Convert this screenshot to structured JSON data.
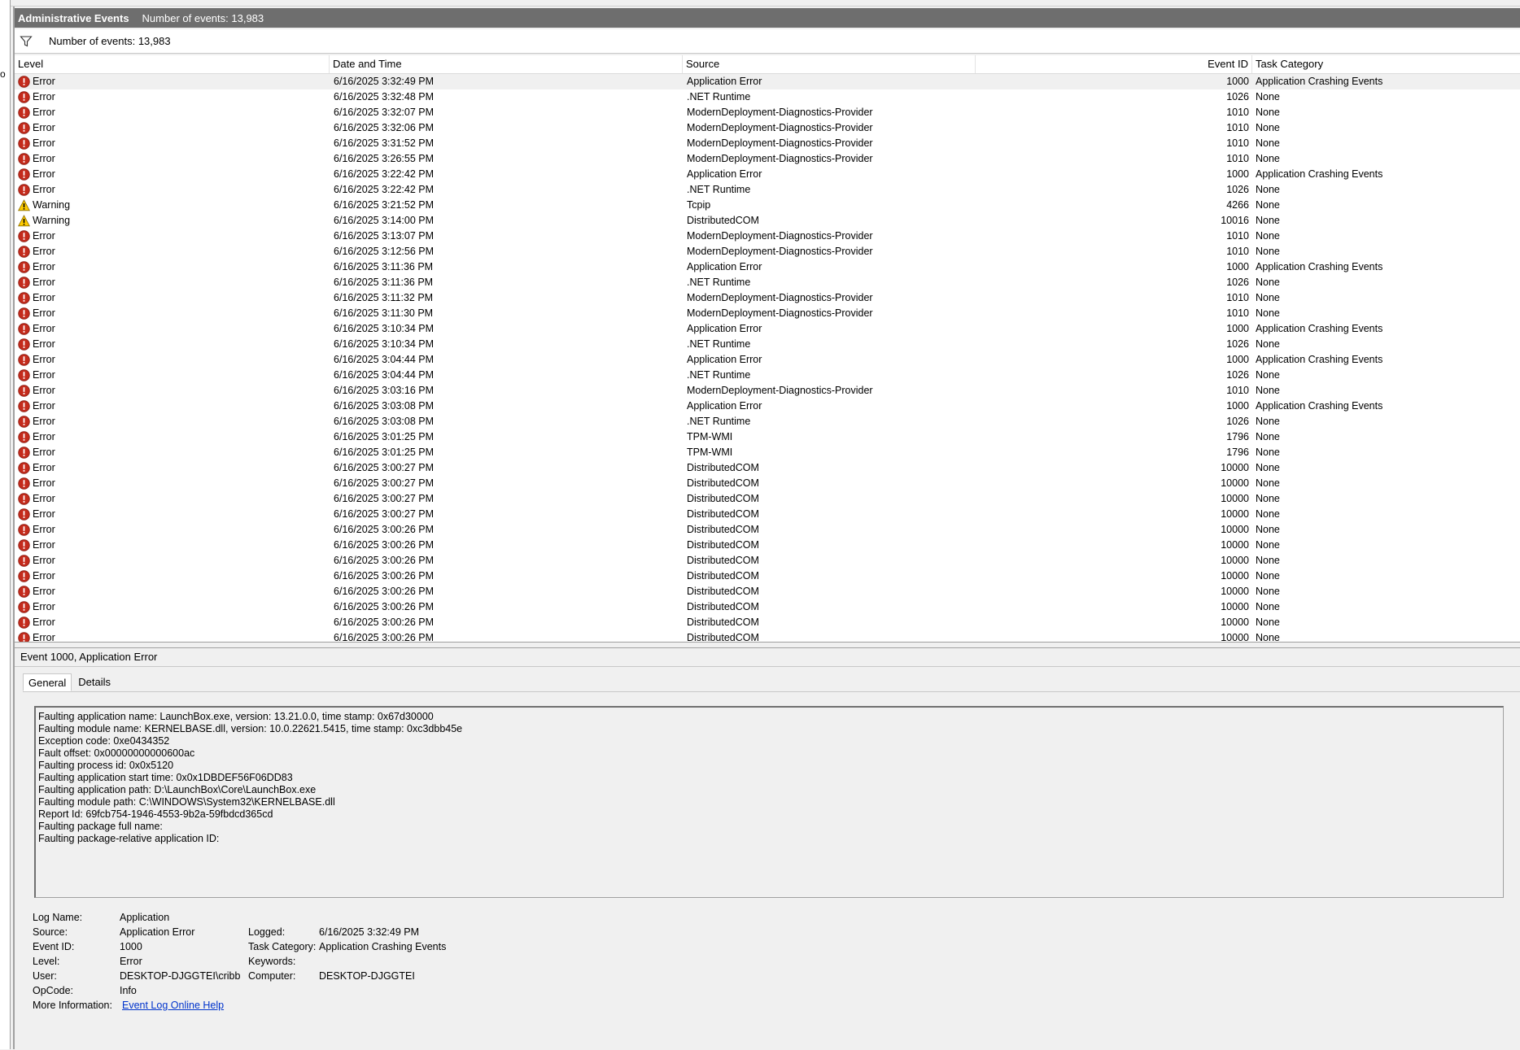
{
  "left_strip_text": "o",
  "header": {
    "title": "Administrative Events",
    "count_text": "Number of events: 13,983"
  },
  "filter_bar": {
    "icon": "filter-funnel-icon",
    "count_text": "Number of events: 13,983"
  },
  "columns": {
    "level": "Level",
    "date": "Date and Time",
    "source": "Source",
    "event_id": "Event ID",
    "task": "Task Category"
  },
  "events": [
    {
      "level": "Error",
      "date": "6/16/2025 3:32:49 PM",
      "source": "Application Error",
      "id": "1000",
      "task": "Application Crashing Events"
    },
    {
      "level": "Error",
      "date": "6/16/2025 3:32:48 PM",
      "source": ".NET Runtime",
      "id": "1026",
      "task": "None"
    },
    {
      "level": "Error",
      "date": "6/16/2025 3:32:07 PM",
      "source": "ModernDeployment-Diagnostics-Provider",
      "id": "1010",
      "task": "None"
    },
    {
      "level": "Error",
      "date": "6/16/2025 3:32:06 PM",
      "source": "ModernDeployment-Diagnostics-Provider",
      "id": "1010",
      "task": "None"
    },
    {
      "level": "Error",
      "date": "6/16/2025 3:31:52 PM",
      "source": "ModernDeployment-Diagnostics-Provider",
      "id": "1010",
      "task": "None"
    },
    {
      "level": "Error",
      "date": "6/16/2025 3:26:55 PM",
      "source": "ModernDeployment-Diagnostics-Provider",
      "id": "1010",
      "task": "None"
    },
    {
      "level": "Error",
      "date": "6/16/2025 3:22:42 PM",
      "source": "Application Error",
      "id": "1000",
      "task": "Application Crashing Events"
    },
    {
      "level": "Error",
      "date": "6/16/2025 3:22:42 PM",
      "source": ".NET Runtime",
      "id": "1026",
      "task": "None"
    },
    {
      "level": "Warning",
      "date": "6/16/2025 3:21:52 PM",
      "source": "Tcpip",
      "id": "4266",
      "task": "None"
    },
    {
      "level": "Warning",
      "date": "6/16/2025 3:14:00 PM",
      "source": "DistributedCOM",
      "id": "10016",
      "task": "None"
    },
    {
      "level": "Error",
      "date": "6/16/2025 3:13:07 PM",
      "source": "ModernDeployment-Diagnostics-Provider",
      "id": "1010",
      "task": "None"
    },
    {
      "level": "Error",
      "date": "6/16/2025 3:12:56 PM",
      "source": "ModernDeployment-Diagnostics-Provider",
      "id": "1010",
      "task": "None"
    },
    {
      "level": "Error",
      "date": "6/16/2025 3:11:36 PM",
      "source": "Application Error",
      "id": "1000",
      "task": "Application Crashing Events"
    },
    {
      "level": "Error",
      "date": "6/16/2025 3:11:36 PM",
      "source": ".NET Runtime",
      "id": "1026",
      "task": "None"
    },
    {
      "level": "Error",
      "date": "6/16/2025 3:11:32 PM",
      "source": "ModernDeployment-Diagnostics-Provider",
      "id": "1010",
      "task": "None"
    },
    {
      "level": "Error",
      "date": "6/16/2025 3:11:30 PM",
      "source": "ModernDeployment-Diagnostics-Provider",
      "id": "1010",
      "task": "None"
    },
    {
      "level": "Error",
      "date": "6/16/2025 3:10:34 PM",
      "source": "Application Error",
      "id": "1000",
      "task": "Application Crashing Events"
    },
    {
      "level": "Error",
      "date": "6/16/2025 3:10:34 PM",
      "source": ".NET Runtime",
      "id": "1026",
      "task": "None"
    },
    {
      "level": "Error",
      "date": "6/16/2025 3:04:44 PM",
      "source": "Application Error",
      "id": "1000",
      "task": "Application Crashing Events"
    },
    {
      "level": "Error",
      "date": "6/16/2025 3:04:44 PM",
      "source": ".NET Runtime",
      "id": "1026",
      "task": "None"
    },
    {
      "level": "Error",
      "date": "6/16/2025 3:03:16 PM",
      "source": "ModernDeployment-Diagnostics-Provider",
      "id": "1010",
      "task": "None"
    },
    {
      "level": "Error",
      "date": "6/16/2025 3:03:08 PM",
      "source": "Application Error",
      "id": "1000",
      "task": "Application Crashing Events"
    },
    {
      "level": "Error",
      "date": "6/16/2025 3:03:08 PM",
      "source": ".NET Runtime",
      "id": "1026",
      "task": "None"
    },
    {
      "level": "Error",
      "date": "6/16/2025 3:01:25 PM",
      "source": "TPM-WMI",
      "id": "1796",
      "task": "None"
    },
    {
      "level": "Error",
      "date": "6/16/2025 3:01:25 PM",
      "source": "TPM-WMI",
      "id": "1796",
      "task": "None"
    },
    {
      "level": "Error",
      "date": "6/16/2025 3:00:27 PM",
      "source": "DistributedCOM",
      "id": "10000",
      "task": "None"
    },
    {
      "level": "Error",
      "date": "6/16/2025 3:00:27 PM",
      "source": "DistributedCOM",
      "id": "10000",
      "task": "None"
    },
    {
      "level": "Error",
      "date": "6/16/2025 3:00:27 PM",
      "source": "DistributedCOM",
      "id": "10000",
      "task": "None"
    },
    {
      "level": "Error",
      "date": "6/16/2025 3:00:27 PM",
      "source": "DistributedCOM",
      "id": "10000",
      "task": "None"
    },
    {
      "level": "Error",
      "date": "6/16/2025 3:00:26 PM",
      "source": "DistributedCOM",
      "id": "10000",
      "task": "None"
    },
    {
      "level": "Error",
      "date": "6/16/2025 3:00:26 PM",
      "source": "DistributedCOM",
      "id": "10000",
      "task": "None"
    },
    {
      "level": "Error",
      "date": "6/16/2025 3:00:26 PM",
      "source": "DistributedCOM",
      "id": "10000",
      "task": "None"
    },
    {
      "level": "Error",
      "date": "6/16/2025 3:00:26 PM",
      "source": "DistributedCOM",
      "id": "10000",
      "task": "None"
    },
    {
      "level": "Error",
      "date": "6/16/2025 3:00:26 PM",
      "source": "DistributedCOM",
      "id": "10000",
      "task": "None"
    },
    {
      "level": "Error",
      "date": "6/16/2025 3:00:26 PM",
      "source": "DistributedCOM",
      "id": "10000",
      "task": "None"
    },
    {
      "level": "Error",
      "date": "6/16/2025 3:00:26 PM",
      "source": "DistributedCOM",
      "id": "10000",
      "task": "None"
    },
    {
      "level": "Error",
      "date": "6/16/2025 3:00:26 PM",
      "source": "DistributedCOM",
      "id": "10000",
      "task": "None"
    }
  ],
  "detail": {
    "title": "Event 1000, Application Error",
    "tabs": [
      "General",
      "Details"
    ],
    "description_lines": [
      "Faulting application name: LaunchBox.exe, version: 13.21.0.0, time stamp: 0x67d30000",
      "Faulting module name: KERNELBASE.dll, version: 10.0.22621.5415, time stamp: 0xc3dbb45e",
      "Exception code: 0xe0434352",
      "Fault offset: 0x00000000000600ac",
      "Faulting process id: 0x0x5120",
      "Faulting application start time: 0x0x1DBDEF56F06DD83",
      "Faulting application path: D:\\LaunchBox\\Core\\LaunchBox.exe",
      "Faulting module path: C:\\WINDOWS\\System32\\KERNELBASE.dll",
      "Report Id: 69fcb754-1946-4553-9b2a-59fbdcd365cd",
      "Faulting package full name:",
      "Faulting package-relative application ID:"
    ],
    "props": {
      "log_name_label": "Log Name:",
      "log_name": "Application",
      "source_label": "Source:",
      "source": "Application Error",
      "logged_label": "Logged:",
      "logged": "6/16/2025 3:32:49 PM",
      "event_id_label": "Event ID:",
      "event_id": "1000",
      "task_label": "Task Category:",
      "task": "Application Crashing Events",
      "level_label": "Level:",
      "level": "Error",
      "keywords_label": "Keywords:",
      "keywords": "",
      "user_label": "User:",
      "user": "DESKTOP-DJGGTEI\\cribb",
      "computer_label": "Computer:",
      "computer": "DESKTOP-DJGGTEI",
      "opcode_label": "OpCode:",
      "opcode": "Info",
      "more_info_label": "More Information:",
      "more_info_link": "Event Log Online Help"
    }
  },
  "colors": {
    "error": "#c42b1c",
    "warning": "#ffcc00",
    "title_bar": "#6e6e6e",
    "link": "#0033cc"
  }
}
